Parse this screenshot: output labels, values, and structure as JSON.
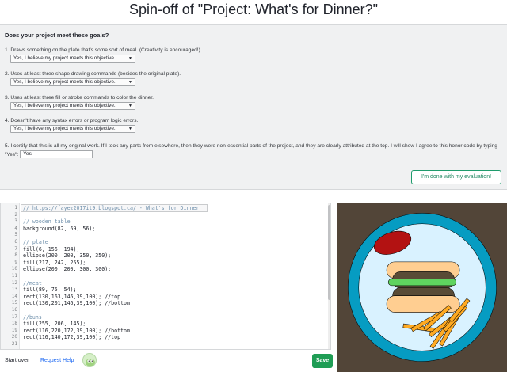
{
  "page": {
    "title": "Spin-off of \"Project: What's for Dinner?\""
  },
  "evaluation": {
    "heading": "Does your project meet these goals?",
    "goals": [
      {
        "text": "1. Draws something on the plate that's some sort of meal. (Creativity is encouraged!)",
        "selected": "Yes, I believe my project meets this objective."
      },
      {
        "text": "2. Uses at least three shape drawing commands (besides the original plate).",
        "selected": "Yes, I believe my project meets this objective."
      },
      {
        "text": "3. Uses at least three fill or stroke commands to color the dinner.",
        "selected": "Yes, I believe my project meets this objective."
      },
      {
        "text": "4. Doesn't have any syntax errors or program logic errors.",
        "selected": "Yes, I believe my project meets this objective."
      }
    ],
    "honor_code": {
      "text": "5. I certify that this is all my original work. If I took any parts from elsewhere, then they were non-essential parts of the project, and they are clearly attributed at the top. I will show I agree to this honor code by typing \"Yes\":",
      "value": "Yes"
    },
    "done_button": "I'm done with my evaluation!"
  },
  "editor": {
    "lines": [
      {
        "n": "1",
        "code": "// https://fayez2017it9.blogspot.ca/ - What's for Dinner",
        "kind": "comment"
      },
      {
        "n": "2",
        "code": "",
        "kind": "code"
      },
      {
        "n": "3",
        "code": "// wooden table",
        "kind": "comment"
      },
      {
        "n": "4",
        "code": "background(82, 69, 56);",
        "kind": "code"
      },
      {
        "n": "5",
        "code": "",
        "kind": "code"
      },
      {
        "n": "6",
        "code": "// plate",
        "kind": "comment"
      },
      {
        "n": "7",
        "code": "fill(6, 156, 194);",
        "kind": "code"
      },
      {
        "n": "8",
        "code": "ellipse(200, 200, 350, 350);",
        "kind": "code"
      },
      {
        "n": "9",
        "code": "fill(217, 242, 255);",
        "kind": "code"
      },
      {
        "n": "10",
        "code": "ellipse(200, 200, 300, 300);",
        "kind": "code"
      },
      {
        "n": "11",
        "code": "",
        "kind": "code"
      },
      {
        "n": "12",
        "code": "//meat",
        "kind": "comment"
      },
      {
        "n": "13",
        "code": "fill(89, 75, 54);",
        "kind": "code"
      },
      {
        "n": "14",
        "code": "rect(130,163,146,39,100); //top",
        "kind": "code"
      },
      {
        "n": "15",
        "code": "rect(130,201,146,39,100); //bottom",
        "kind": "code"
      },
      {
        "n": "16",
        "code": "",
        "kind": "code"
      },
      {
        "n": "17",
        "code": "//buns",
        "kind": "comment"
      },
      {
        "n": "18",
        "code": "fill(255, 206, 145);",
        "kind": "code"
      },
      {
        "n": "19",
        "code": "rect(116,220,172,39,100); //bottom",
        "kind": "code"
      },
      {
        "n": "20",
        "code": "rect(116,140,172,39,100); //top",
        "kind": "code"
      },
      {
        "n": "21",
        "code": "",
        "kind": "code"
      }
    ]
  },
  "footer": {
    "start_over": "Start over",
    "request_help": "Request Help",
    "save": "Save"
  },
  "icons": {
    "avatar": "green-blob-avatar-icon",
    "select_caret": "caret-down-icon"
  },
  "colors": {
    "accent_green": "#1f9d55",
    "link_blue": "#1865f2",
    "table_brown": "#524538",
    "plate_blue": "#069cc2",
    "plate_inner": "#d9f2ff",
    "meat": "#594b36",
    "bun": "#ffce91",
    "lettuce": "#5fd35f",
    "sauce_red": "#b31212",
    "fries": "#ffaa22"
  }
}
